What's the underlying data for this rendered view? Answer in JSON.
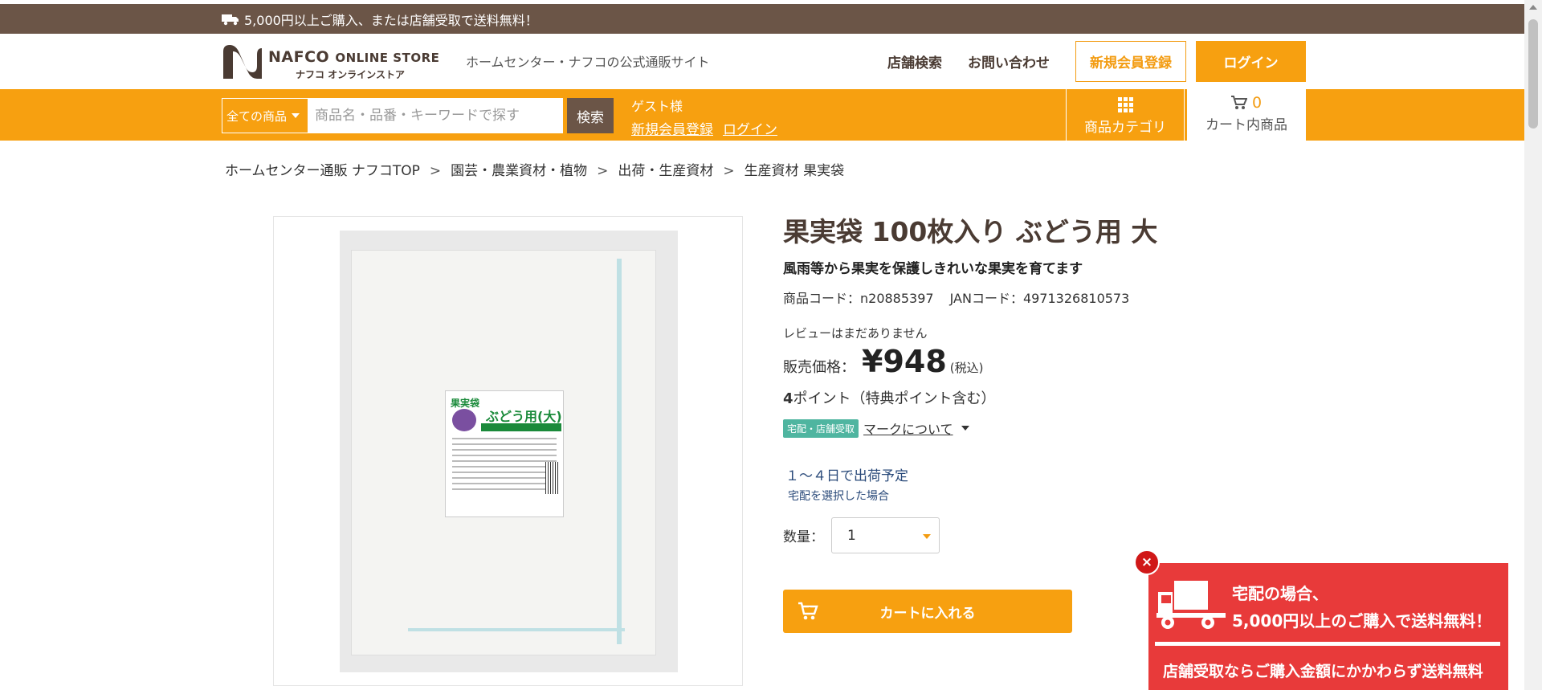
{
  "topbar": {
    "message": "5,000円以上ご購入、または店舗受取で送料無料！",
    "icon": "truck-icon"
  },
  "header": {
    "logo_en": "NAFCO",
    "logo_en_suffix": "ONLINE STORE",
    "logo_jp": "ナフコ オンラインストア",
    "tagline": "ホームセンター・ナフコの公式通販サイト",
    "store_search": "店舗検索",
    "contact": "お問い合わせ",
    "register": "新規会員登録",
    "login": "ログイン"
  },
  "navbar": {
    "category_select": "全ての商品",
    "search_placeholder": "商品名・品番・キーワードで探す",
    "search_button": "検索",
    "guest_label": "ゲスト様",
    "guest_register": "新規会員登録",
    "guest_login": "ログイン",
    "category_button": "商品カテゴリ",
    "cart_count": "0",
    "cart_label": "カート内商品"
  },
  "breadcrumb": {
    "separator": ">",
    "items": [
      "ホームセンター通販 ナフコTOP",
      "園芸・農業資材・植物",
      "出荷・生産資材",
      "生産資材 果実袋"
    ]
  },
  "product": {
    "image_label_title": "果実袋",
    "image_label_name": "ぶどう用(大)",
    "title": "果実袋 100枚入り ぶどう用 大",
    "subtitle": "風雨等から果実を保護しきれいな果実を育てます",
    "product_code": "商品コード：n20885397",
    "jan_code": "JANコード：4971326810573",
    "review": "レビューはまだありません",
    "price_label": "販売価格：",
    "price": "¥948",
    "tax_note": "(税込)",
    "points_value": "4",
    "points_text": "ポイント（特典ポイント含む）",
    "badge": "宅配・店舗受取",
    "mark_link": "マークについて",
    "shipping": "１～４日で出荷予定",
    "shipping_note": "宅配を選択した場合",
    "quantity_label": "数量：",
    "quantity_value": "1",
    "add_to_cart": "カートに入れる"
  },
  "promo": {
    "line1": "宅配の場合、",
    "line2": "5,000円以上のご購入で送料無料！",
    "line3": "店舗受取ならご購入金額にかかわらず送料無料",
    "close": "×"
  },
  "colors": {
    "brown": "#6b5547",
    "orange": "#f7a010",
    "promo_red": "#e83a3a",
    "badge_teal": "#4fb5a0"
  }
}
